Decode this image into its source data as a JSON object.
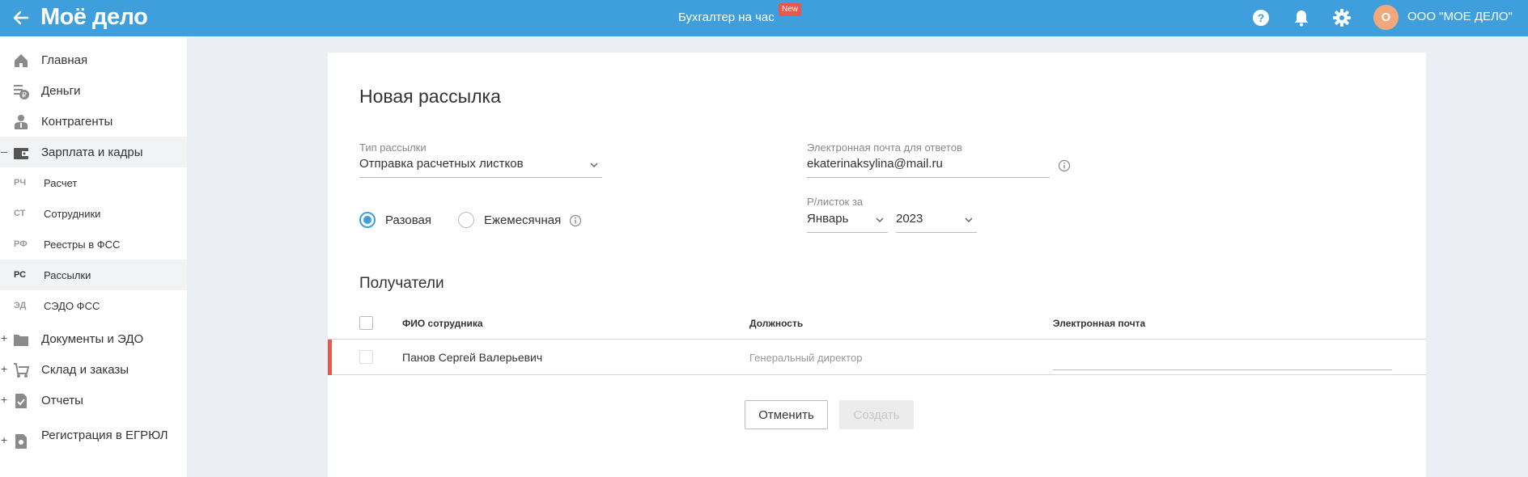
{
  "header": {
    "logo_text": "Моё дело",
    "center_title": "Бухгалтер на час",
    "new_badge": "New",
    "avatar_letter": "О",
    "org_name": "ООО \"МОЕ ДЕЛО\"",
    "icons": [
      "back-arrow-icon",
      "help-icon",
      "bell-icon",
      "gear-icon"
    ]
  },
  "sidebar": {
    "items": [
      {
        "label": "Главная",
        "icon": "home-icon"
      },
      {
        "label": "Деньги",
        "icon": "money-icon"
      },
      {
        "label": "Контрагенты",
        "icon": "contractors-icon"
      },
      {
        "label": "Зарплата и кадры",
        "icon": "wallet-icon",
        "toggle": "–"
      },
      {
        "label": "Документы и ЭДО",
        "icon": "documents-icon",
        "toggle": "+"
      },
      {
        "label": "Склад и заказы",
        "icon": "warehouse-icon",
        "toggle": "+"
      },
      {
        "label": "Отчеты",
        "icon": "reports-icon",
        "toggle": "+"
      },
      {
        "label": "Регистрация в ЕГРЮЛ",
        "icon": "registration-icon",
        "toggle": "+"
      }
    ],
    "subitems": [
      {
        "abbr": "РЧ",
        "label": "Расчет"
      },
      {
        "abbr": "СТ",
        "label": "Сотрудники"
      },
      {
        "abbr": "РФ",
        "label": "Реестры в ФСС"
      },
      {
        "abbr": "РС",
        "label": "Рассылки"
      },
      {
        "abbr": "ЭД",
        "label": "СЭДО ФСС"
      }
    ]
  },
  "form": {
    "title": "Новая рассылка",
    "type_label": "Тип рассылки",
    "type_value": "Отправка расчетных листков",
    "email_label": "Электронная почта для ответов",
    "email_value": "ekaterinaksylina@mail.ru",
    "radio_once": "Разовая",
    "radio_monthly": "Ежемесячная",
    "payslip_label": "Р/листок за",
    "month_value": "Январь",
    "year_value": "2023"
  },
  "recipients": {
    "title": "Получатели",
    "columns": [
      "ФИО сотрудника",
      "Должность",
      "Электронная почта"
    ],
    "rows": [
      {
        "name": "Панов Сергей Валерьевич",
        "position": "Генеральный директор",
        "email": ""
      }
    ]
  },
  "actions": {
    "cancel": "Отменить",
    "create": "Создать"
  },
  "colors": {
    "accent": "#3f9fdc",
    "error_marker": "#e8574b",
    "badge": "#e8574b",
    "avatar": "#f2a87a"
  }
}
